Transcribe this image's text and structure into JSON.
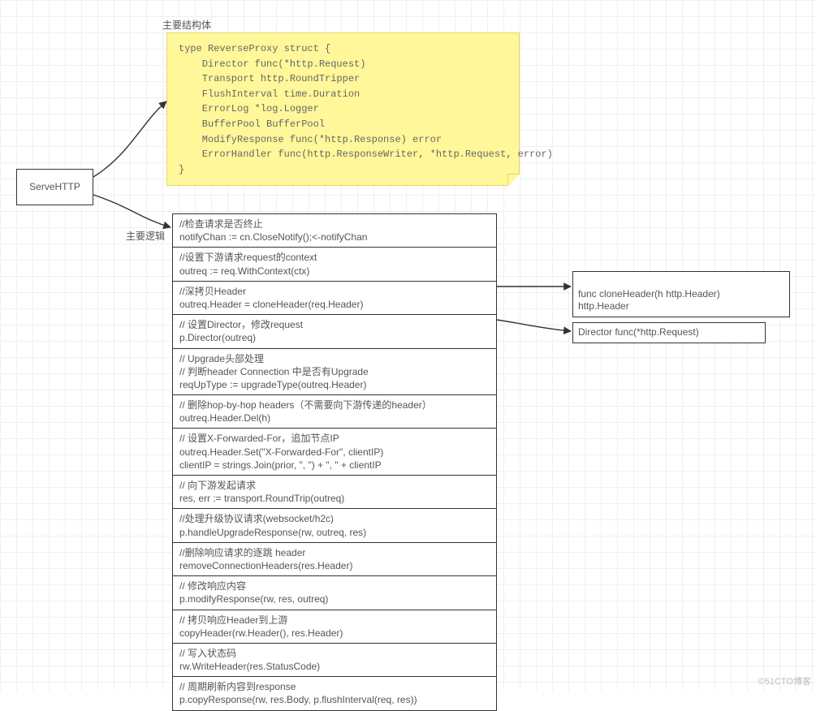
{
  "labels": {
    "struct_label": "主要结构体",
    "logic_label": "主要逻辑"
  },
  "serve_http": "ServeHTTP",
  "struct_code": "type ReverseProxy struct {\n    Director func(*http.Request)\n    Transport http.RoundTripper\n    FlushInterval time.Duration\n    ErrorLog *log.Logger\n    BufferPool BufferPool\n    ModifyResponse func(*http.Response) error\n    ErrorHandler func(http.ResponseWriter, *http.Request, error)\n}",
  "steps": [
    "//检查请求是否终止\nnotifyChan := cn.CloseNotify();<-notifyChan",
    "//设置下游请求request的context\n outreq := req.WithContext(ctx)",
    "//深拷贝Header\noutreq.Header = cloneHeader(req.Header)",
    "// 设置Director，修改request\np.Director(outreq)",
    "// Upgrade头部处理\n// 判断header Connection 中是否有Upgrade\n reqUpType := upgradeType(outreq.Header)",
    "// 删除hop-by-hop headers（不需要向下游传递的header）\noutreq.Header.Del(h)",
    "// 设置X-Forwarded-For，追加节点IP\noutreq.Header.Set(\"X-Forwarded-For\", clientIP)\nclientIP = strings.Join(prior, \", \") + \", \" + clientIP",
    "// 向下游发起请求\n res, err := transport.RoundTrip(outreq)",
    "//处理升级协议请求(websocket/h2c)\np.handleUpgradeResponse(rw, outreq, res)",
    "//删除响应请求的逐跳 header\nremoveConnectionHeaders(res.Header)",
    "// 修改响应内容\np.modifyResponse(rw, res, outreq)",
    "// 拷贝响应Header到上游\n copyHeader(rw.Header(), res.Header)",
    "// 写入状态码\n rw.WriteHeader(res.StatusCode)",
    "// 周期刷新内容到response\np.copyResponse(rw, res.Body, p.flushInterval(req, res))"
  ],
  "side_boxes": {
    "clone_header": "func cloneHeader(h http.Header)\nhttp.Header",
    "director": "Director func(*http.Request)"
  },
  "watermark": "©51CTO博客"
}
